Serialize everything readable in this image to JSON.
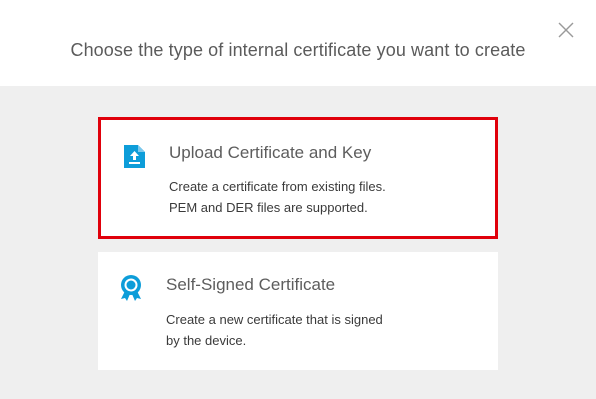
{
  "dialog": {
    "title": "Choose the type of internal certificate you want to create",
    "close_icon": "close-icon"
  },
  "options": [
    {
      "icon": "upload-file-icon",
      "title": "Upload Certificate and Key",
      "description_lines": [
        "Create a certificate from existing files.",
        "PEM and DER files are supported."
      ],
      "selected": true
    },
    {
      "icon": "certificate-badge-icon",
      "title": "Self-Signed Certificate",
      "description_lines": [
        "Create a new certificate that is signed",
        "by the device."
      ],
      "selected": false
    }
  ],
  "colors": {
    "accent_icon": "#0d9dd9",
    "selection_border": "#e0000b",
    "background": "#efefef"
  }
}
